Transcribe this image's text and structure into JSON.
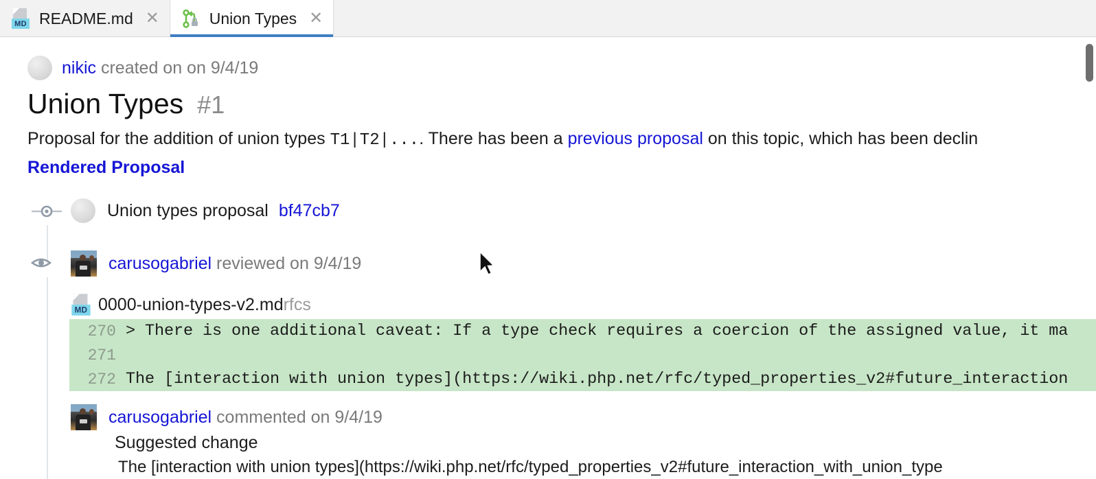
{
  "window": {
    "accent_color": "#3f7ec1",
    "diff_add_color": "#c7e6c7",
    "link_color": "#1515d6"
  },
  "tabs": [
    {
      "id": "readme",
      "label": "README.md",
      "icon": "markdown-file-icon",
      "badge": "MD",
      "close_glyph": "✕",
      "active": false
    },
    {
      "id": "union-types",
      "label": "Union Types",
      "icon": "pull-request-icon",
      "close_glyph": "✕",
      "active": true
    }
  ],
  "issue": {
    "author": "nikic",
    "action": "created on on",
    "date": "9/4/19",
    "title": "Union Types",
    "number": "#1",
    "body_prefix": "Proposal for the addition of union types ",
    "body_code": "T1|T2|...",
    "body_mid": ". There has been a ",
    "body_link": "previous proposal",
    "body_suffix": " on this topic, which has been declin",
    "rendered_link": "Rendered Proposal"
  },
  "timeline": [
    {
      "kind": "commit",
      "icon": "git-commit-icon",
      "avatar": "generic-avatar",
      "message": "Union types proposal",
      "sha": "bf47cb7"
    },
    {
      "kind": "review",
      "icon": "eye-icon",
      "avatar": "carusogabriel-avatar",
      "author": "carusogabriel",
      "action": "reviewed on",
      "date": "9/4/19"
    }
  ],
  "diff": {
    "file_icon": "markdown-file-icon",
    "file_badge": "MD",
    "filename": "0000-union-types-v2.md",
    "repo_path": "rfcs",
    "lines": [
      {
        "number": "270",
        "code": "> There is one additional caveat: If a type check requires a coercion of the assigned value, it ma"
      },
      {
        "number": "271",
        "code": ""
      },
      {
        "number": "272",
        "code": "The [interaction with union types](https://wiki.php.net/rfc/typed_properties_v2#future_interaction"
      }
    ]
  },
  "comment": {
    "avatar": "carusogabriel-avatar",
    "author": "carusogabriel",
    "action": "commented on",
    "date": "9/4/19",
    "heading": "Suggested change",
    "body": "The [interaction with union types](https://wiki.php.net/rfc/typed_properties_v2#future_interaction_with_union_type"
  },
  "scrollbar": {
    "name": "vertical-scrollbar-thumb",
    "position_percent": 2
  }
}
